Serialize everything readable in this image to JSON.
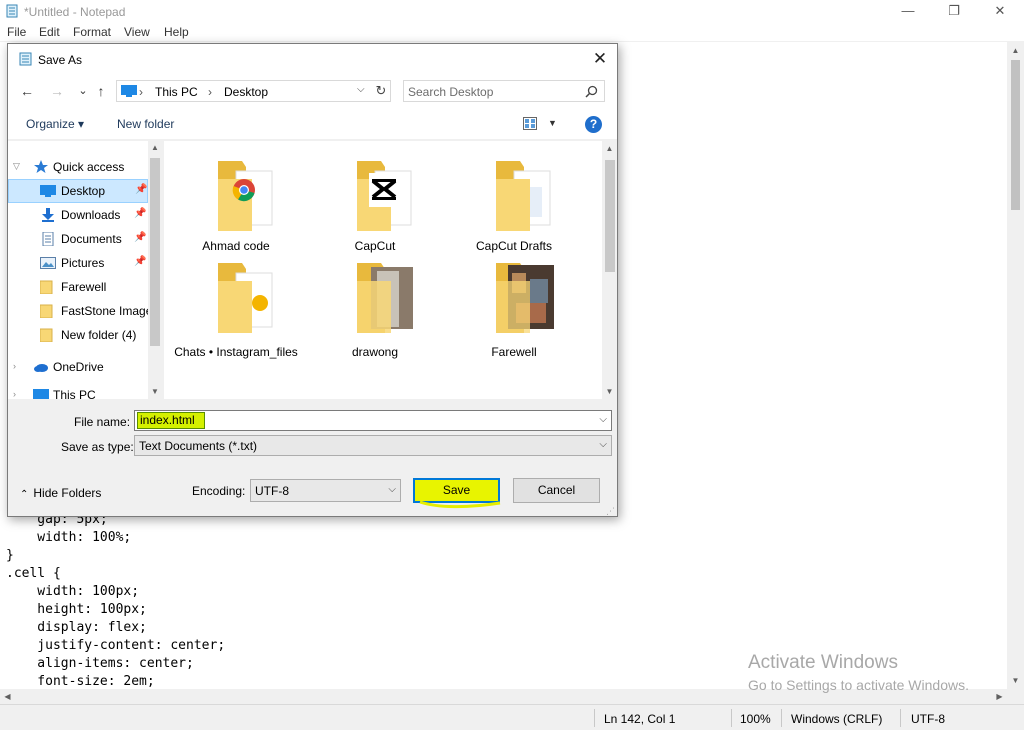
{
  "notepad": {
    "title": "*Untitled - Notepad",
    "menu": [
      "File",
      "Edit",
      "Format",
      "View",
      "Help"
    ],
    "window_buttons": {
      "minimize": "—",
      "restore": "❐",
      "close": "✕"
    },
    "code_lines": [
      "    gap: 5px;",
      "    width: 100%;",
      "}",
      ".cell {",
      "    width: 100px;",
      "    height: 100px;",
      "    display: flex;",
      "    justify-content: center;",
      "    align-items: center;",
      "    font-size: 2em;"
    ],
    "status": {
      "position": "Ln 142, Col 1",
      "zoom": "100%",
      "line_ending": "Windows (CRLF)",
      "encoding": "UTF-8"
    },
    "watermark": {
      "line1": "Activate Windows",
      "line2": "Go to Settings to activate Windows."
    }
  },
  "dialog": {
    "title": "Save As",
    "close_glyph": "✕",
    "nav_buttons": {
      "back": "←",
      "forward": "→",
      "recent": "⌄",
      "up": "↑"
    },
    "breadcrumb": [
      "This PC",
      "Desktop"
    ],
    "breadcrumb_sep": "›",
    "refresh_glyph": "↻",
    "search_placeholder": "Search Desktop",
    "toolbar": {
      "organize": "Organize ▾",
      "new_folder": "New folder",
      "help": "?"
    },
    "nav_items": [
      {
        "label": "Quick access",
        "icon": "star-icon"
      },
      {
        "label": "Desktop",
        "icon": "desktop-icon",
        "pinned": true,
        "selected": true
      },
      {
        "label": "Downloads",
        "icon": "download-icon",
        "pinned": true
      },
      {
        "label": "Documents",
        "icon": "document-icon",
        "pinned": true
      },
      {
        "label": "Pictures",
        "icon": "picture-icon",
        "pinned": true
      },
      {
        "label": "Farewell",
        "icon": "folder-icon"
      },
      {
        "label": "FastStone Image",
        "icon": "folder-icon"
      },
      {
        "label": "New folder (4)",
        "icon": "folder-icon"
      },
      {
        "label": "OneDrive",
        "icon": "cloud-icon"
      },
      {
        "label": "This PC",
        "icon": "pc-icon"
      }
    ],
    "files": [
      {
        "name": "Ahmad code",
        "overlay": "chrome"
      },
      {
        "name": "CapCut",
        "overlay": "capcut"
      },
      {
        "name": "CapCut Drafts",
        "overlay": "doc"
      },
      {
        "name": "Chats • Instagram_files",
        "overlay": "chrome"
      },
      {
        "name": "drawong",
        "overlay": "photo-gray"
      },
      {
        "name": "Farewell",
        "overlay": "photo-color"
      }
    ],
    "file_name_label": "File name:",
    "file_name_value": "index.html",
    "save_type_label": "Save as type:",
    "save_type_value": "Text Documents (*.txt)",
    "hide_folders": "Hide Folders",
    "encoding_label": "Encoding:",
    "encoding_value": "UTF-8",
    "save_label": "Save",
    "cancel_label": "Cancel"
  },
  "colors": {
    "highlight": "#d4f000",
    "accent": "#0078d7",
    "folder": "#f8d775",
    "selected_bg": "#cce8ff"
  }
}
